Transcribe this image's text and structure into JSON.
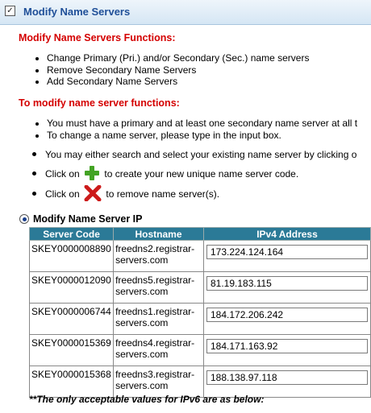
{
  "header": {
    "title": "Modify Name Servers",
    "checkbox_mark": "✓"
  },
  "functions_section": {
    "title": "Modify Name Servers Functions:",
    "items": [
      "Change Primary (Pri.) and/or Secondary (Sec.) name servers",
      "Remove Secondary Name Servers",
      "Add Secondary Name Servers"
    ]
  },
  "modify_section": {
    "title": "To modify name server functions:",
    "items": [
      "You must have a primary and at least one secondary name server at all t",
      "To change a name server, please type in the input box."
    ],
    "search_text": "You may either search and select your existing name server by clicking o",
    "click_on": "Click on",
    "add_text": "to create your new unique name server code.",
    "remove_text": "to remove name server(s)."
  },
  "ip_section": {
    "radio_label": "Modify Name Server IP",
    "columns": [
      "Server Code",
      "Hostname",
      "IPv4 Address"
    ],
    "rows": [
      {
        "code": "SKEY0000008890",
        "host1": "freedns2.registrar-",
        "host2": "servers.com",
        "ip": "173.224.124.164"
      },
      {
        "code": "SKEY0000012090",
        "host1": "freedns5.registrar-",
        "host2": "servers.com",
        "ip": "81.19.183.115"
      },
      {
        "code": "SKEY0000006744",
        "host1": "freedns1.registrar-",
        "host2": "servers.com",
        "ip": "184.172.206.242"
      },
      {
        "code": "SKEY0000015369",
        "host1": "freedns4.registrar-",
        "host2": "servers.com",
        "ip": "184.171.163.92"
      },
      {
        "code": "SKEY0000015368",
        "host1": "freedns3.registrar-",
        "host2": "servers.com",
        "ip": "188.138.97.118"
      }
    ]
  },
  "footnote": "**The only acceptable values for IPv6 are as below:",
  "colors": {
    "header_text": "#1f4f98",
    "section_title": "#d40000",
    "table_header": "#2b7a97",
    "add_icon": "#43a324",
    "remove_icon": "#cc1b1b"
  }
}
